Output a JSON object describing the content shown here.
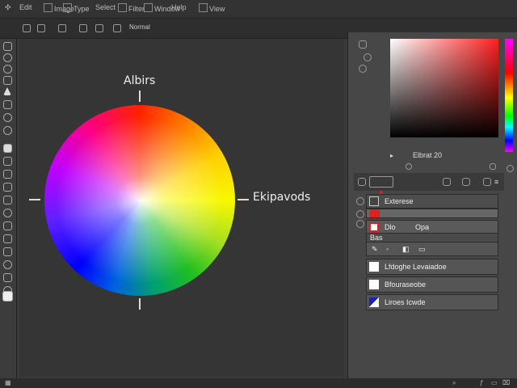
{
  "menubar": {
    "items": [
      "Edit",
      "Image",
      "Type",
      "Select",
      "Filter",
      "Window",
      "Help",
      "View"
    ]
  },
  "options": {
    "label": "Normal"
  },
  "canvas": {
    "label_top": "Albirs",
    "label_right": "Ekipavods"
  },
  "color_panel": {
    "hex_label": "Elbrat 20"
  },
  "layers": {
    "header": "Exterese",
    "active_row": {
      "name": "Dlo",
      "mode": "Opa"
    },
    "sub_label": "Bas",
    "rows": [
      {
        "name": "Lfdoghe Levaiadoe"
      },
      {
        "name": "Bfouraseobe"
      },
      {
        "name": "Liroes Icwde"
      }
    ]
  },
  "colors": {
    "accent_red": "#e02020",
    "thumb_blue": "#2020c0"
  },
  "icons": [
    "move-icon",
    "marquee-icon",
    "lasso-icon",
    "crop-icon",
    "brush-icon",
    "eraser-icon",
    "text-icon",
    "hand-icon",
    "zoom-icon",
    "eyedropper-icon",
    "lock-icon",
    "eye-icon",
    "link-icon",
    "trash-icon",
    "folder-icon"
  ]
}
